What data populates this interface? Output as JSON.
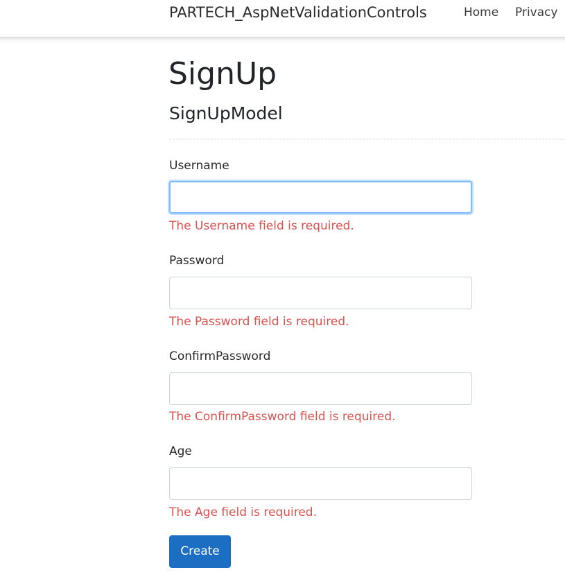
{
  "navbar": {
    "brand": "PARTECH_AspNetValidationControls",
    "links": [
      "Home",
      "Privacy"
    ]
  },
  "page": {
    "title": "SignUp",
    "model_title": "SignUpModel"
  },
  "form": {
    "fields": [
      {
        "label": "Username",
        "value": "",
        "error": "The Username field is required.",
        "focused": true
      },
      {
        "label": "Password",
        "value": "",
        "error": "The Password field is required.",
        "focused": false
      },
      {
        "label": "ConfirmPassword",
        "value": "",
        "error": "The ConfirmPassword field is required.",
        "focused": false
      },
      {
        "label": "Age",
        "value": "",
        "error": "The Age field is required.",
        "focused": false
      }
    ],
    "submit_label": "Create"
  },
  "colors": {
    "error": "#d9534f",
    "primary_button": "#1b6ec2",
    "focus_border": "#80bdff"
  }
}
